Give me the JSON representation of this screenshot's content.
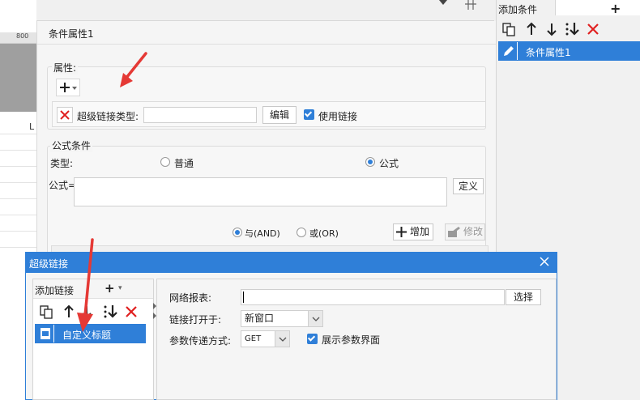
{
  "background": {
    "ruler_label": "800",
    "column_letter": "L"
  },
  "condition_panel": {
    "title": "条件属性1",
    "attributes": {
      "label": "属性:",
      "hyperlink_type_label": "超级链接类型:",
      "hyperlink_type_value": "",
      "edit_button": "编辑",
      "use_link_label": "使用链接",
      "use_link_checked": true
    },
    "formula_condition": {
      "label": "公式条件",
      "type_label": "类型:",
      "type_options": [
        "普通",
        "公式"
      ],
      "type_selected": "公式",
      "formula_label": "公式=",
      "formula_value": "",
      "define_button": "定义",
      "logic_options": [
        "与(AND)",
        "或(OR)"
      ],
      "logic_selected": "与(AND)",
      "add_button": "增加",
      "modify_button": "修改"
    }
  },
  "add_condition_pane": {
    "title": "添加条件",
    "items": [
      "条件属性1"
    ],
    "selected_item": "条件属性1"
  },
  "hyperlink_dialog": {
    "title": "超级链接",
    "add_link_label": "添加链接",
    "items": [
      "自定义标题"
    ],
    "web_report_label": "网络报表:",
    "web_report_value": "",
    "select_button": "选择",
    "open_in_label": "链接打开于:",
    "open_in_value": "新窗口",
    "param_method_label": "参数传递方式:",
    "param_method_value": "GET",
    "show_param_label": "展示参数界面",
    "show_param_checked": true
  },
  "colors": {
    "accent": "#2f7fd8",
    "annotation_arrow": "#e53935",
    "delete_red": "#e02020"
  }
}
